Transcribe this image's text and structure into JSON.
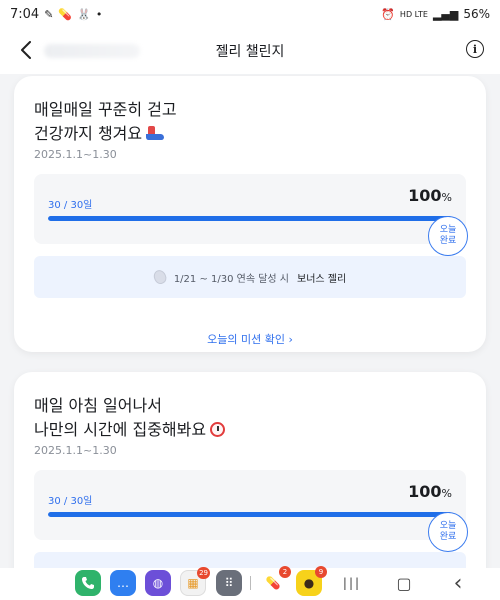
{
  "status_bar": {
    "time": "7:04",
    "left_icons": [
      "pen-icon",
      "pill-icon",
      "rabbit-icon",
      "dot-icon"
    ],
    "network": "HD LTE",
    "battery": "56%"
  },
  "header": {
    "title": "젤리 챌린지",
    "info_symbol": "i"
  },
  "challenges": [
    {
      "title_line1": "매일매일 꾸준히 걷고",
      "title_line2": "건강까지 챙겨요",
      "title_icon": "running-shoe-icon",
      "period": "2025.1.1~1.30",
      "progress_count": "30 / 30일",
      "progress_percent": "100",
      "progress_unit": "%",
      "progress_fraction": 1.0,
      "done_badge_line1": "오늘",
      "done_badge_line2": "완료",
      "bonus_text": "1/21 ~ 1/30 연속 달성 시",
      "bonus_reward": "보너스 젤리",
      "mission_link": "오늘의 미션 확인 ›"
    },
    {
      "title_line1": "매일 아침 일어나서",
      "title_line2": "나만의 시간에 집중해봐요",
      "title_icon": "alarm-clock-icon",
      "period": "2025.1.1~1.30",
      "progress_count": "30 / 30일",
      "progress_percent": "100",
      "progress_unit": "%",
      "progress_fraction": 1.0,
      "done_badge_line1": "오늘",
      "done_badge_line2": "완료"
    }
  ],
  "dock": {
    "apps": [
      {
        "name": "phone-app-icon",
        "color": "#2fb36b",
        "badge": ""
      },
      {
        "name": "messages-app-icon",
        "color": "#2f7ff0",
        "badge": ""
      },
      {
        "name": "internet-app-icon",
        "color": "#6c4fd8",
        "badge": ""
      },
      {
        "name": "games-folder-icon",
        "color": "#f2f2f2",
        "badge": "29"
      },
      {
        "name": "apps-grid-icon",
        "color": "#6a6f7a",
        "badge": ""
      },
      {
        "name": "pill-app-icon",
        "color": "#ffffff",
        "badge": "2"
      },
      {
        "name": "kakaotalk-app-icon",
        "color": "#f7d21b",
        "badge": "9"
      }
    ],
    "recents_symbol": "|||",
    "home_symbol": "▢",
    "back_symbol": "‹"
  }
}
